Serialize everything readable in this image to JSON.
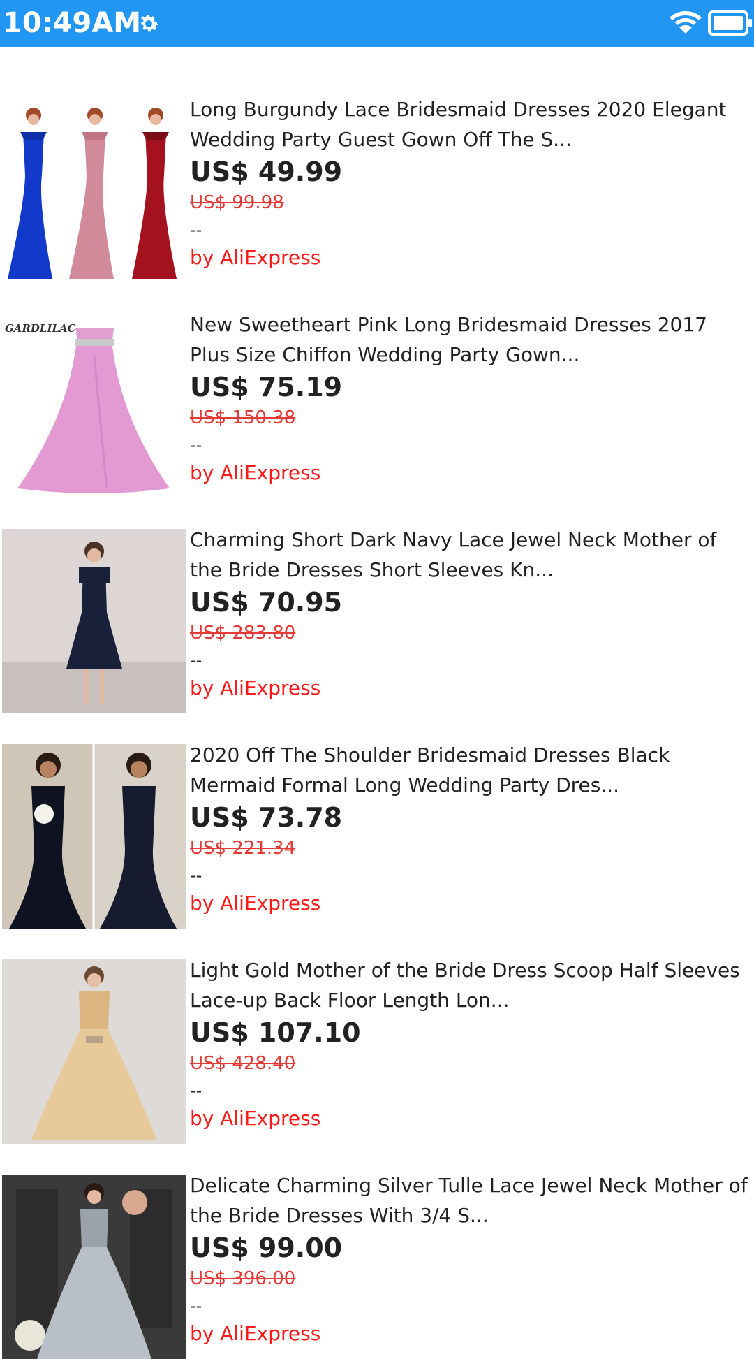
{
  "status_bar": {
    "time": "10:49AM",
    "icons": [
      "gear-icon",
      "wifi-icon",
      "battery-icon"
    ],
    "color": "#2196f3"
  },
  "products": [
    {
      "title": "Long Burgundy Lace Bridesmaid Dresses 2020 Elegant Wedding Party Guest Gown Off The S...",
      "price": "US$ 49.99",
      "original_price": "US$ 99.98",
      "rating": "--",
      "seller": "by AliExpress"
    },
    {
      "title": "New Sweetheart Pink Long Bridesmaid Dresses 2017 Plus Size Chiffon Wedding Party Gown...",
      "price": "US$ 75.19",
      "original_price": "US$ 150.38",
      "rating": "--",
      "seller": "by AliExpress",
      "image_watermark": "GARDLILAC"
    },
    {
      "title": "Charming Short Dark Navy Lace Jewel Neck Mother of the Bride Dresses Short Sleeves Kn...",
      "price": "US$ 70.95",
      "original_price": "US$ 283.80",
      "rating": "--",
      "seller": "by AliExpress"
    },
    {
      "title": "2020 Off The Shoulder Bridesmaid Dresses Black Mermaid Formal Long Wedding Party Dres...",
      "price": "US$ 73.78",
      "original_price": "US$ 221.34",
      "rating": "--",
      "seller": "by AliExpress"
    },
    {
      "title": "Light Gold Mother of the Bride Dress Scoop Half Sleeves Lace-up Back Floor Length Lon...",
      "price": "US$ 107.10",
      "original_price": "US$ 428.40",
      "rating": "--",
      "seller": "by AliExpress"
    },
    {
      "title": "Delicate Charming Silver Tulle Lace Jewel Neck Mother of the Bride Dresses With 3/4 S...",
      "price": "US$ 99.00",
      "original_price": "US$ 396.00",
      "rating": "--",
      "seller": "by AliExpress"
    }
  ]
}
